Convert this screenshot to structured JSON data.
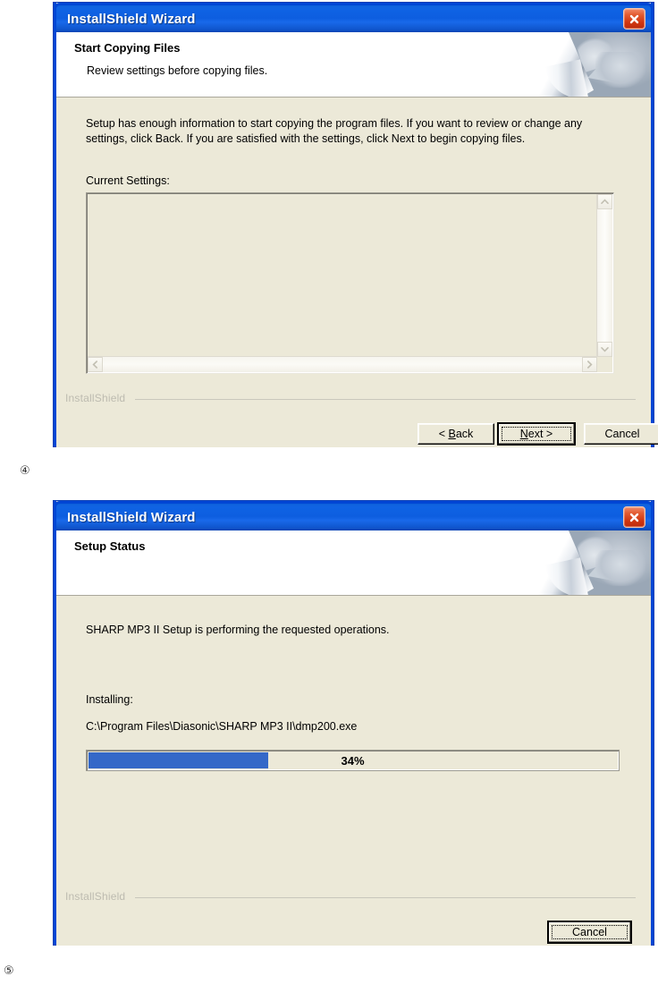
{
  "page": {
    "captions": [
      {
        "label": "④",
        "n": 4
      },
      {
        "label": "⑤",
        "n": 5
      }
    ]
  },
  "colors": {
    "titlebar_blue": "#0d5ee0",
    "dialog_border": "#0046d5",
    "dialog_face": "#ece9d8",
    "close_red": "#cf3510",
    "progress_fill": "#3468c8",
    "footer_brand": "#bdbbb0"
  },
  "dialog1": {
    "window_title": "InstallShield Wizard",
    "close_icon": "close-icon",
    "banner": {
      "title": "Start Copying Files",
      "subtitle": "Review settings before copying files."
    },
    "body_text": "Setup has enough information to start copying the program files.  If you want to review or change any settings, click Back.  If you are satisfied with the settings, click Next to begin copying files.",
    "settings_label": "Current Settings:",
    "settings_value": "",
    "scrollbars": {
      "up_icon": "chevron-up-icon",
      "down_icon": "chevron-down-icon",
      "left_icon": "chevron-left-icon",
      "right_icon": "chevron-right-icon"
    },
    "footer_brand": "InstallShield",
    "buttons": {
      "back": {
        "pre": "< ",
        "accel": "B",
        "post": "ack"
      },
      "next": {
        "pre": "",
        "accel": "N",
        "post": "ext >"
      },
      "cancel": {
        "label": "Cancel"
      }
    }
  },
  "dialog2": {
    "window_title": "InstallShield Wizard",
    "close_icon": "close-icon",
    "banner": {
      "title": "Setup Status",
      "subtitle": ""
    },
    "body_text": "SHARP MP3 II Setup is performing the requested operations.",
    "installing_label": "Installing:",
    "install_path": "C:\\Program Files\\Diasonic\\SHARP MP3 II\\dmp200.exe",
    "progress": {
      "percent": 34,
      "label": "34%"
    },
    "footer_brand": "InstallShield",
    "buttons": {
      "cancel": {
        "label": "Cancel"
      }
    }
  }
}
